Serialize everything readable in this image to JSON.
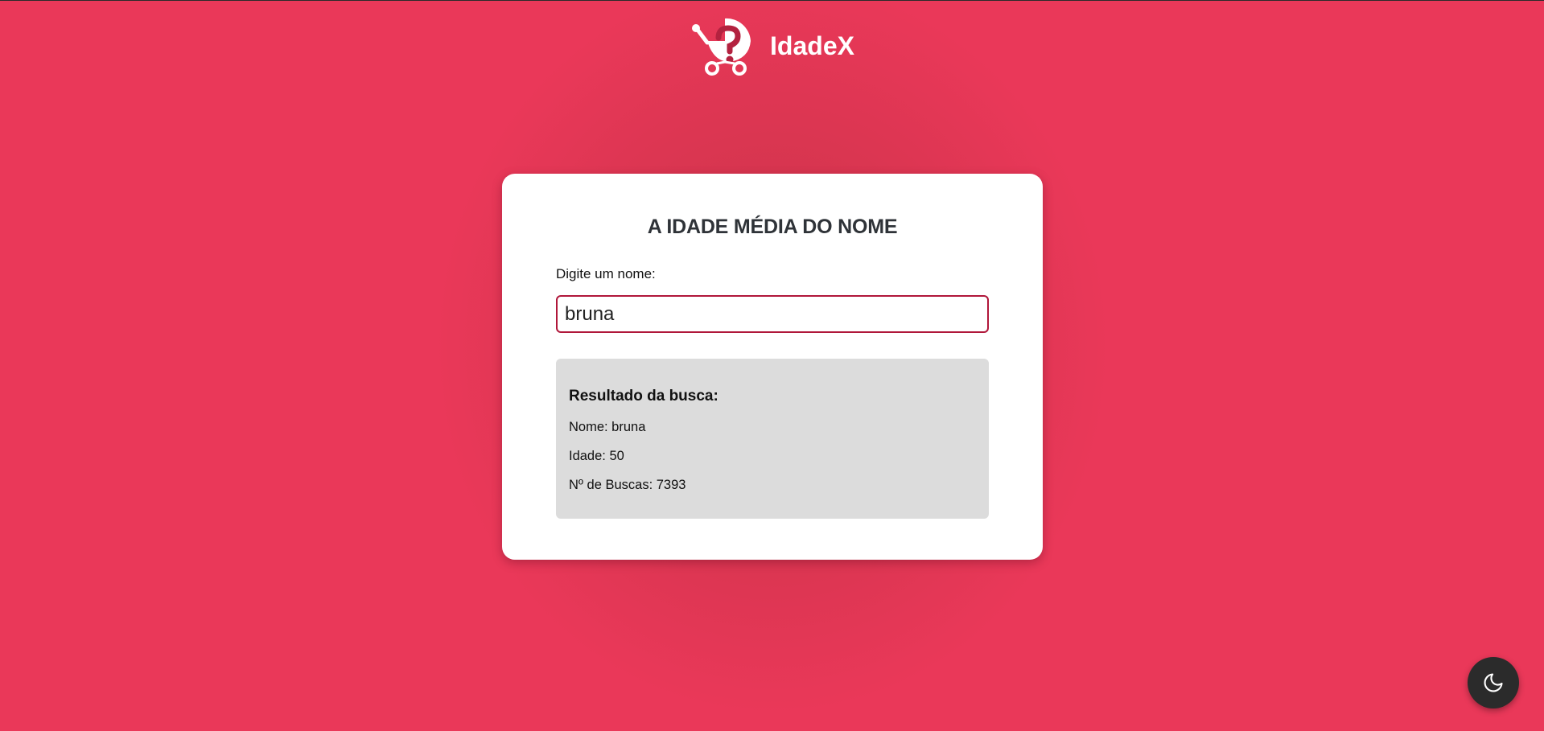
{
  "header": {
    "brand_name": "IdadeX",
    "logo_icon": "baby-stroller-question-icon"
  },
  "card": {
    "title": "A IDADE MÉDIA DO NOME",
    "input_label": "Digite um nome:",
    "input_value": "bruna"
  },
  "result": {
    "title": "Resultado da busca:",
    "name_line": "Nome: bruna",
    "age_line": "Idade: 50",
    "searches_line": "Nº de Buscas: 7393"
  },
  "theme_toggle": {
    "icon": "moon-icon"
  },
  "colors": {
    "background": "#ea3859",
    "background_center": "#c8304c",
    "card": "#ffffff",
    "input_border": "#b0173a",
    "result_box": "#dcdcdc",
    "toggle": "#2b2b2b"
  }
}
